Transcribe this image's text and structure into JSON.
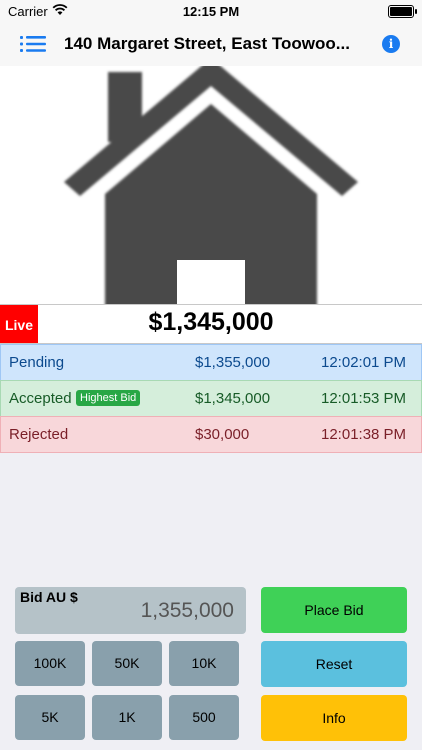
{
  "status_bar": {
    "carrier": "Carrier",
    "time": "12:15 PM"
  },
  "nav": {
    "title": "140 Margaret Street, East Toowoo...",
    "menu_icon": "list-icon",
    "info_icon": "info-circle-icon",
    "info_glyph": "i"
  },
  "hero": {
    "image_icon": "house-icon"
  },
  "auction": {
    "live_label": "Live",
    "current_price": "$1,345,000"
  },
  "bids": [
    {
      "status": "Pending",
      "amount": "$1,355,000",
      "time": "12:02:01 PM"
    },
    {
      "status": "Accepted",
      "badge": "Highest Bid",
      "amount": "$1,345,000",
      "time": "12:01:53 PM"
    },
    {
      "status": "Rejected",
      "amount": "$30,000",
      "time": "12:01:38 PM"
    }
  ],
  "bid_input": {
    "label": "Bid AU $",
    "value": "1,355,000"
  },
  "increments": [
    "100K",
    "50K",
    "10K",
    "5K",
    "1K",
    "500"
  ],
  "actions": {
    "place_bid": "Place Bid",
    "reset": "Reset",
    "info": "Info"
  },
  "colors": {
    "live": "#ff0000",
    "accent": "#1a7bf0",
    "place_bid": "#3fd157",
    "reset": "#5bc0de",
    "info": "#ffc107"
  }
}
